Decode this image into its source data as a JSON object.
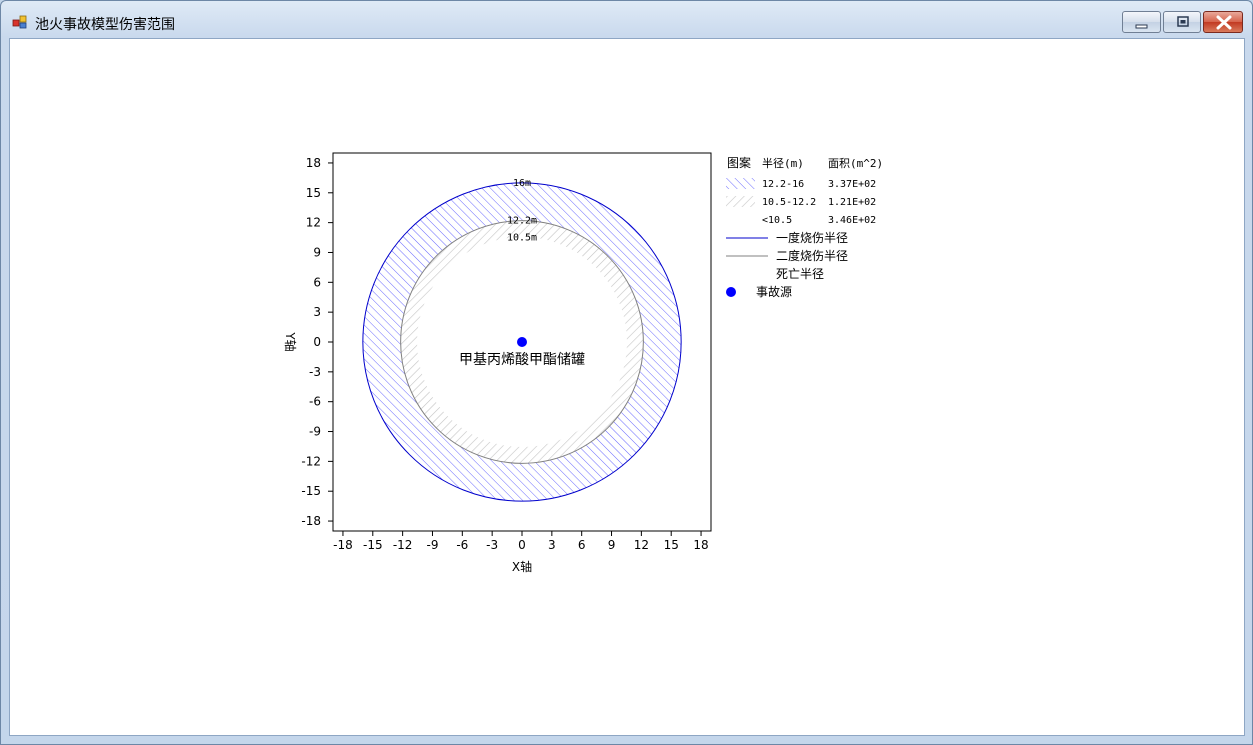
{
  "window": {
    "title": "池火事故模型伤害范围"
  },
  "chart_data": {
    "type": "scatter",
    "xlabel": "X轴",
    "ylabel": "Y轴",
    "xlim": [
      -19,
      19
    ],
    "ylim": [
      -19,
      19
    ],
    "xticks": [
      -18,
      -15,
      -12,
      -9,
      -6,
      -3,
      0,
      3,
      6,
      9,
      12,
      15,
      18
    ],
    "yticks": [
      -18,
      -15,
      -12,
      -9,
      -6,
      -3,
      0,
      3,
      6,
      9,
      12,
      15,
      18
    ],
    "grid": false,
    "legend_position": "right",
    "source": {
      "x": 0,
      "y": 0,
      "label": "甲基丙烯酸甲酯储罐",
      "color": "#0000ff"
    },
    "circles": [
      {
        "name": "一度烧伤半径",
        "radius": 16,
        "label": "16m",
        "color": "#0000cc"
      },
      {
        "name": "二度烧伤半径",
        "radius": 12.2,
        "label": "12.2m",
        "color": "#808080"
      },
      {
        "name": "死亡半径",
        "radius": 10.5,
        "label": "10.5m",
        "color": "#ffffff"
      }
    ],
    "zones": [
      {
        "radius_range": "12.2-16",
        "area": "3.37E+02",
        "color": "#4b4bff",
        "pattern": "blue-hatch"
      },
      {
        "radius_range": "10.5-12.2",
        "area": "1.21E+02",
        "color": "#a8a8a8",
        "pattern": "gray-hatch"
      },
      {
        "radius_range": "<10.5",
        "area": "3.46E+02",
        "color": "#ffffff",
        "pattern": "none"
      }
    ],
    "legend": {
      "header_pattern": "图案",
      "header_radius": "半径(m)",
      "header_area": "面积(m^2)",
      "source_label": "事故源"
    }
  }
}
